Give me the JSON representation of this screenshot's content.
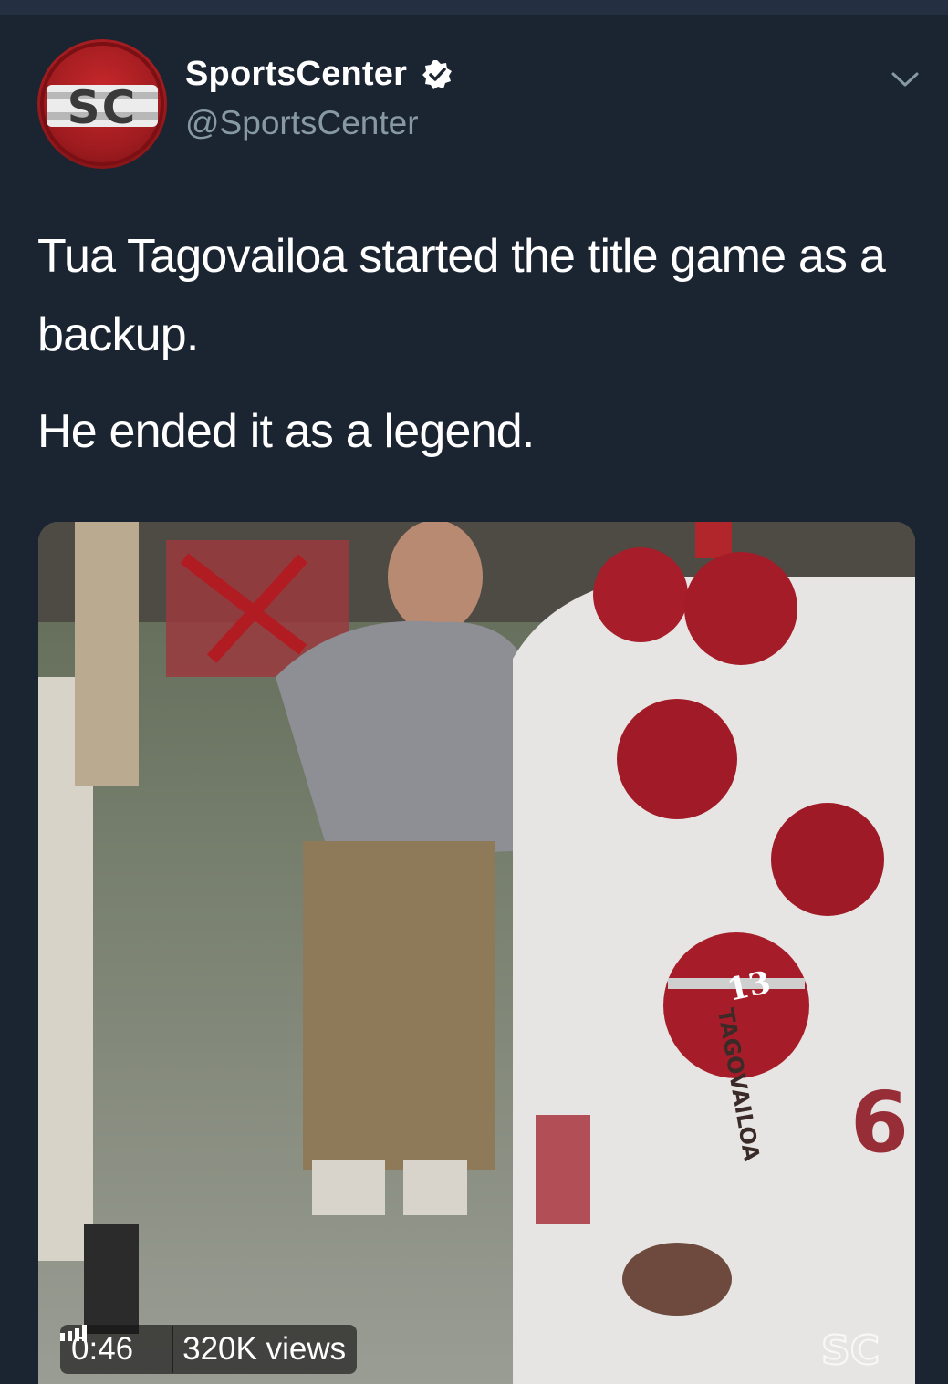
{
  "tweet": {
    "author": {
      "display_name": "SportsCenter",
      "handle": "@SportsCenter",
      "verified_icon": "verified-badge-icon",
      "avatar_logo_text": "SC"
    },
    "menu_icon": "chevron-down-icon",
    "text": [
      "Tua Tagovailoa started the title game as a backup.",
      "He ended it as a legend."
    ],
    "media": {
      "type": "video",
      "duration": "0:46",
      "views": "320K views",
      "watermark": "SC",
      "jersey_name": "TAGOVAILOA",
      "helmet_number": "13"
    }
  },
  "colors": {
    "background": "#1b2431",
    "handle_text": "#8899a6",
    "brand_red": "#c7282b"
  }
}
